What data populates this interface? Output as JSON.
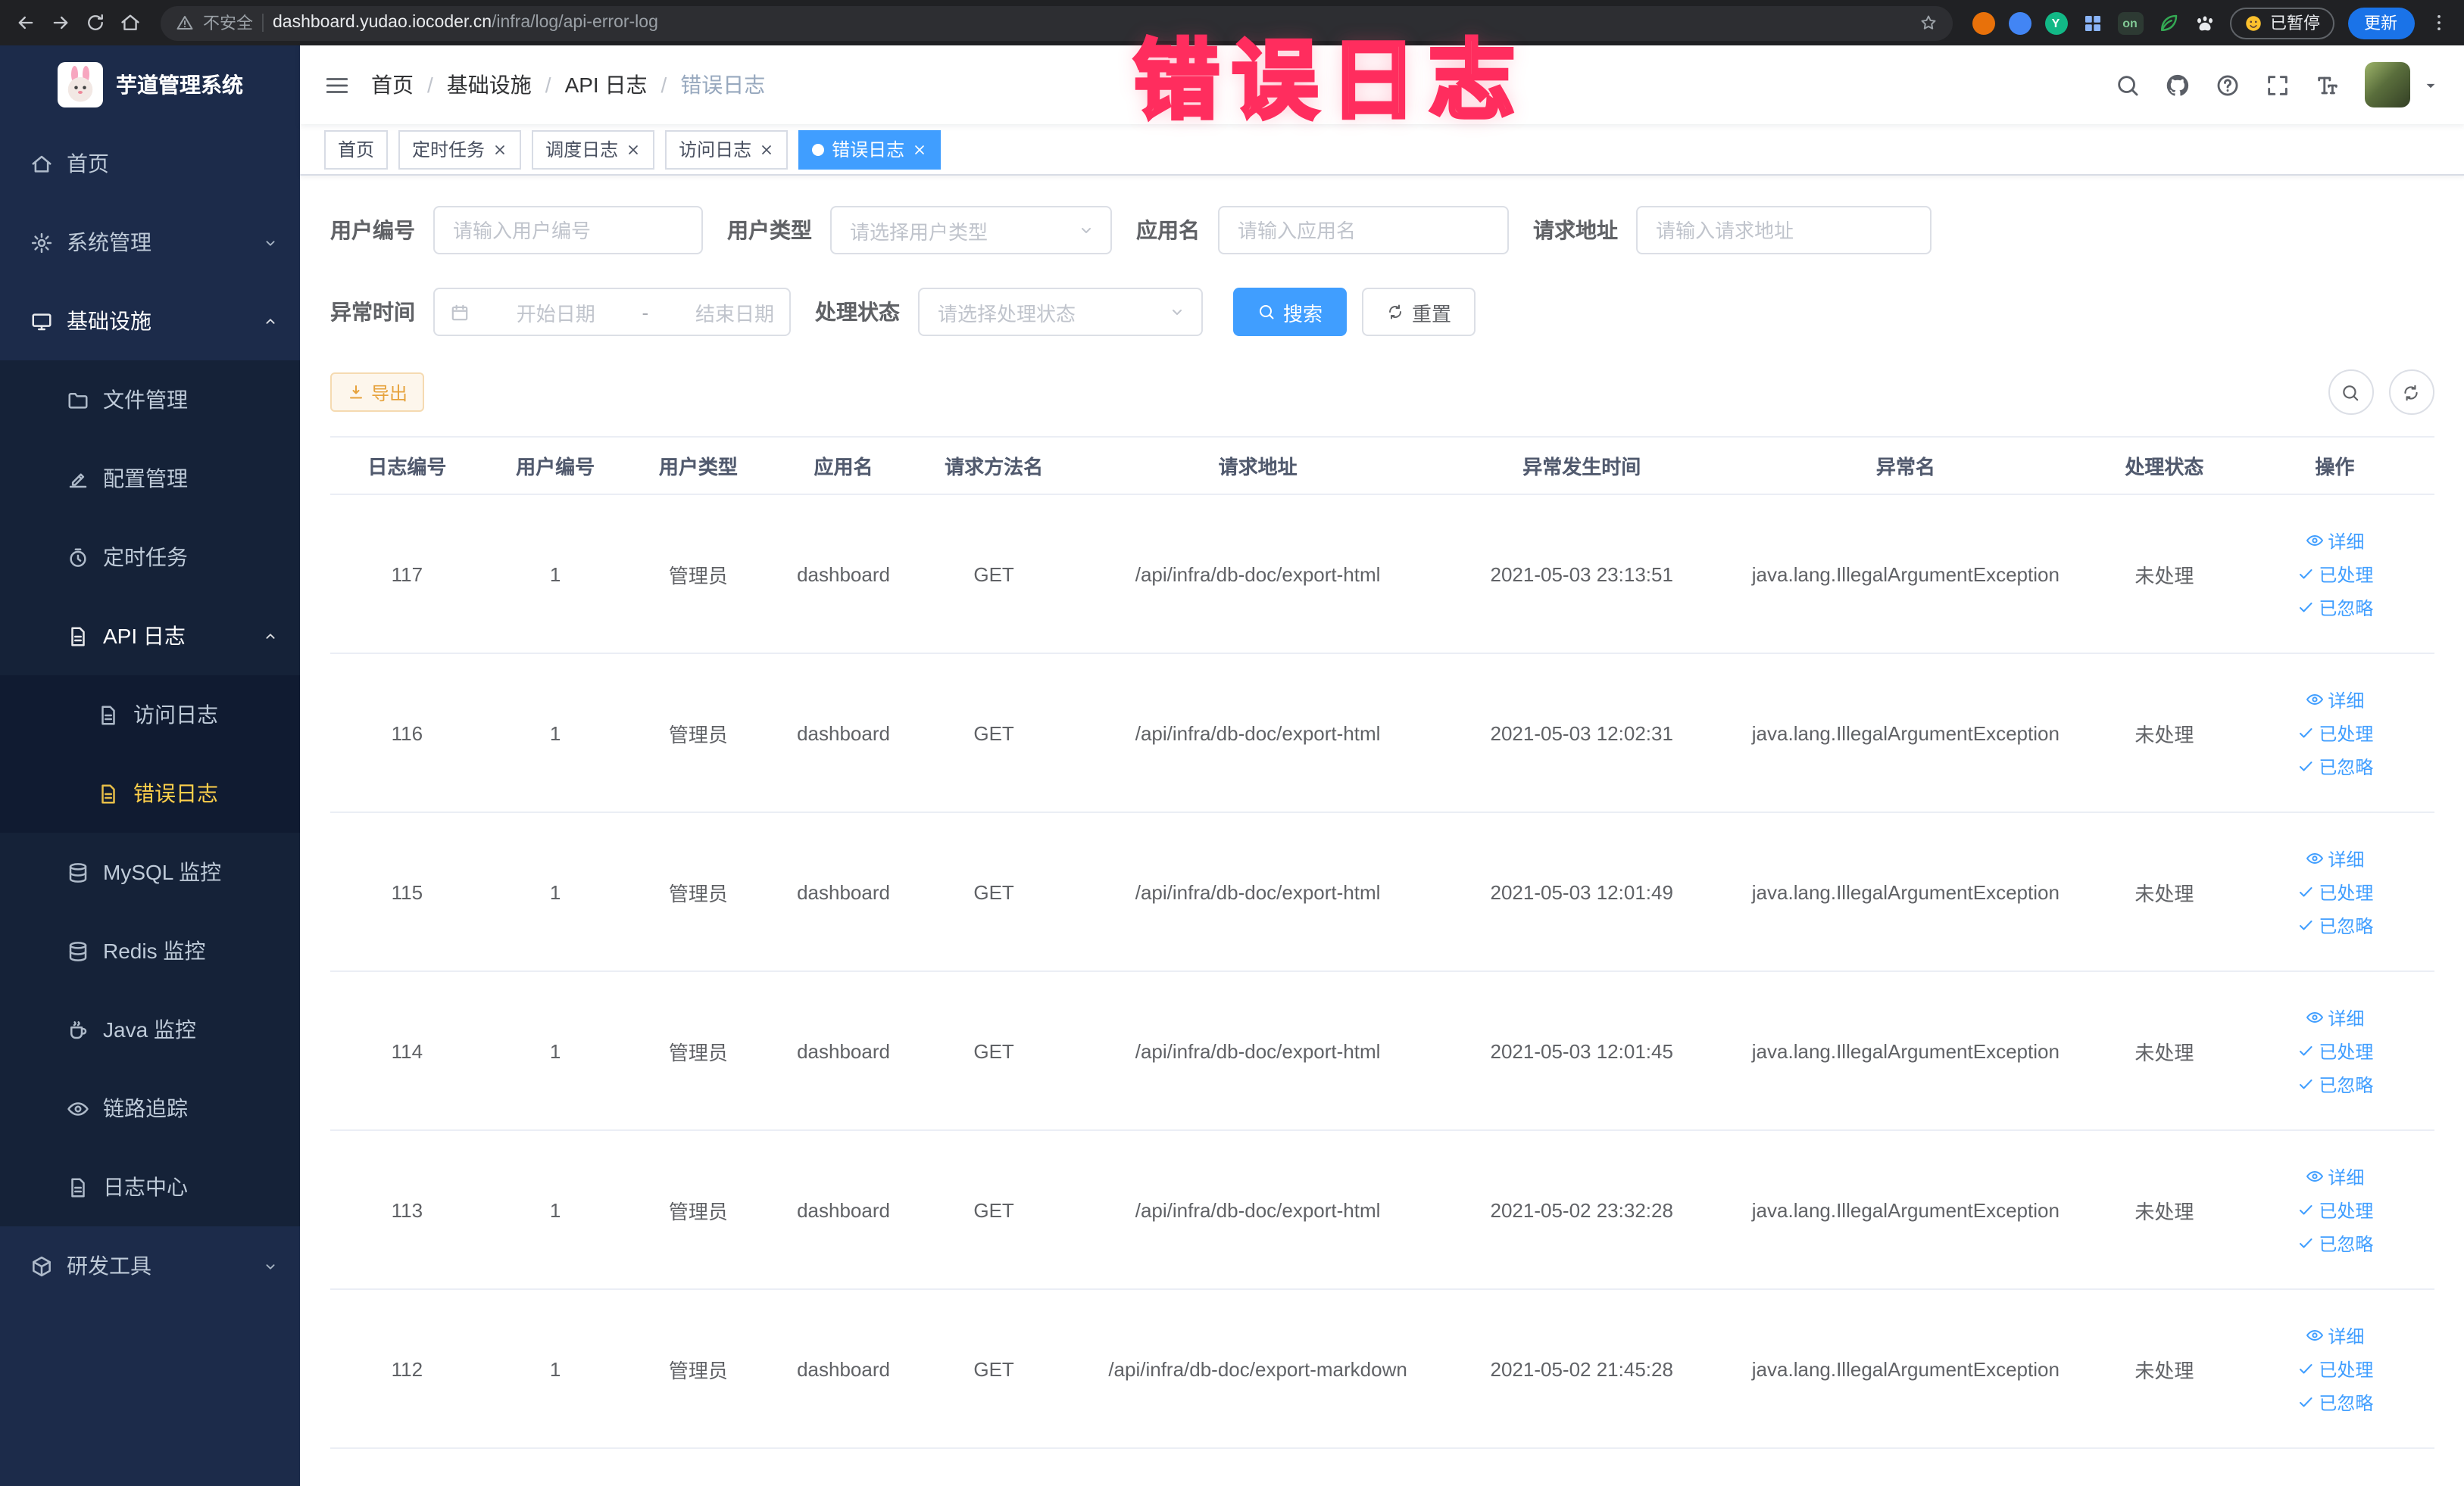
{
  "browser": {
    "security_label": "不安全",
    "url_domain": "dashboard.yudao.iocoder.cn",
    "url_path": "/infra/log/api-error-log",
    "extension_y_badge": "Y",
    "extensions_on_badge": "on",
    "paused_badge": "已暂停",
    "update_button": "更新"
  },
  "annotation": {
    "text": "错误日志"
  },
  "theme": {
    "accent": "#409eff",
    "menu_active": "#ffd04b",
    "warning": "#e6a23c",
    "annotation_pink": "#ff2d5e",
    "sidebar_bg": "#1c2b4a"
  },
  "sidebar": {
    "logo_title": "芋道管理系统",
    "menu": [
      {
        "label": "首页",
        "icon": "home-icon",
        "level": 1
      },
      {
        "label": "系统管理",
        "icon": "gear-icon",
        "level": 1,
        "expandable": true,
        "expanded": false
      },
      {
        "label": "基础设施",
        "icon": "infra-icon",
        "level": 1,
        "expandable": true,
        "expanded": true
      },
      {
        "label": "文件管理",
        "icon": "file-icon",
        "level": 2
      },
      {
        "label": "配置管理",
        "icon": "config-icon",
        "level": 2
      },
      {
        "label": "定时任务",
        "icon": "timer-icon",
        "level": 2
      },
      {
        "label": "API 日志",
        "icon": "log-icon",
        "level": 2,
        "expandable": true,
        "expanded": true
      },
      {
        "label": "访问日志",
        "icon": "doc-icon",
        "level": 3
      },
      {
        "label": "错误日志",
        "icon": "doc-icon",
        "level": 3,
        "active": true
      },
      {
        "label": "MySQL 监控",
        "icon": "db-icon",
        "level": 2
      },
      {
        "label": "Redis 监控",
        "icon": "db-icon",
        "level": 2
      },
      {
        "label": "Java 监控",
        "icon": "java-icon",
        "level": 2
      },
      {
        "label": "链路追踪",
        "icon": "eye-icon",
        "level": 2
      },
      {
        "label": "日志中心",
        "icon": "doc-icon",
        "level": 2
      },
      {
        "label": "研发工具",
        "icon": "tools-icon",
        "level": 1,
        "expandable": true,
        "expanded": false
      }
    ]
  },
  "navbar": {
    "separator": "/",
    "breadcrumb": [
      {
        "label": "首页"
      },
      {
        "label": "基础设施"
      },
      {
        "label": "API 日志"
      },
      {
        "label": "错误日志",
        "current": true
      }
    ]
  },
  "tabs": [
    {
      "label": "首页",
      "active": false,
      "closable": false
    },
    {
      "label": "定时任务",
      "active": false,
      "closable": true
    },
    {
      "label": "调度日志",
      "active": false,
      "closable": true
    },
    {
      "label": "访问日志",
      "active": false,
      "closable": true
    },
    {
      "label": "错误日志",
      "active": true,
      "closable": true
    }
  ],
  "filters": {
    "user_id_label": "用户编号",
    "user_id_placeholder": "请输入用户编号",
    "user_type_label": "用户类型",
    "user_type_placeholder": "请选择用户类型",
    "app_name_label": "应用名",
    "app_name_placeholder": "请输入应用名",
    "request_url_label": "请求地址",
    "request_url_placeholder": "请输入请求地址",
    "exception_time_label": "异常时间",
    "date_start_placeholder": "开始日期",
    "date_separator": "-",
    "date_end_placeholder": "结束日期",
    "status_label": "处理状态",
    "status_placeholder": "请选择处理状态",
    "search_button": "搜索",
    "reset_button": "重置"
  },
  "toolbar": {
    "export_button": "导出"
  },
  "table": {
    "columns": [
      "日志编号",
      "用户编号",
      "用户类型",
      "应用名",
      "请求方法名",
      "请求地址",
      "异常发生时间",
      "异常名",
      "处理状态",
      "操作"
    ],
    "action_labels": {
      "detail": "详细",
      "processed": "已处理",
      "ignored": "已忽略"
    },
    "rows": [
      {
        "id": "117",
        "user_id": "1",
        "user_type": "管理员",
        "app": "dashboard",
        "method": "GET",
        "url": "/api/infra/db-doc/export-html",
        "time": "2021-05-03 23:13:51",
        "exception": "java.lang.IllegalArgumentException",
        "status": "未处理"
      },
      {
        "id": "116",
        "user_id": "1",
        "user_type": "管理员",
        "app": "dashboard",
        "method": "GET",
        "url": "/api/infra/db-doc/export-html",
        "time": "2021-05-03 12:02:31",
        "exception": "java.lang.IllegalArgumentException",
        "status": "未处理"
      },
      {
        "id": "115",
        "user_id": "1",
        "user_type": "管理员",
        "app": "dashboard",
        "method": "GET",
        "url": "/api/infra/db-doc/export-html",
        "time": "2021-05-03 12:01:49",
        "exception": "java.lang.IllegalArgumentException",
        "status": "未处理"
      },
      {
        "id": "114",
        "user_id": "1",
        "user_type": "管理员",
        "app": "dashboard",
        "method": "GET",
        "url": "/api/infra/db-doc/export-html",
        "time": "2021-05-03 12:01:45",
        "exception": "java.lang.IllegalArgumentException",
        "status": "未处理"
      },
      {
        "id": "113",
        "user_id": "1",
        "user_type": "管理员",
        "app": "dashboard",
        "method": "GET",
        "url": "/api/infra/db-doc/export-html",
        "time": "2021-05-02 23:32:28",
        "exception": "java.lang.IllegalArgumentException",
        "status": "未处理"
      },
      {
        "id": "112",
        "user_id": "1",
        "user_type": "管理员",
        "app": "dashboard",
        "method": "GET",
        "url": "/api/infra/db-doc/export-markdown",
        "time": "2021-05-02 21:45:28",
        "exception": "java.lang.IllegalArgumentException",
        "status": "未处理"
      }
    ]
  }
}
